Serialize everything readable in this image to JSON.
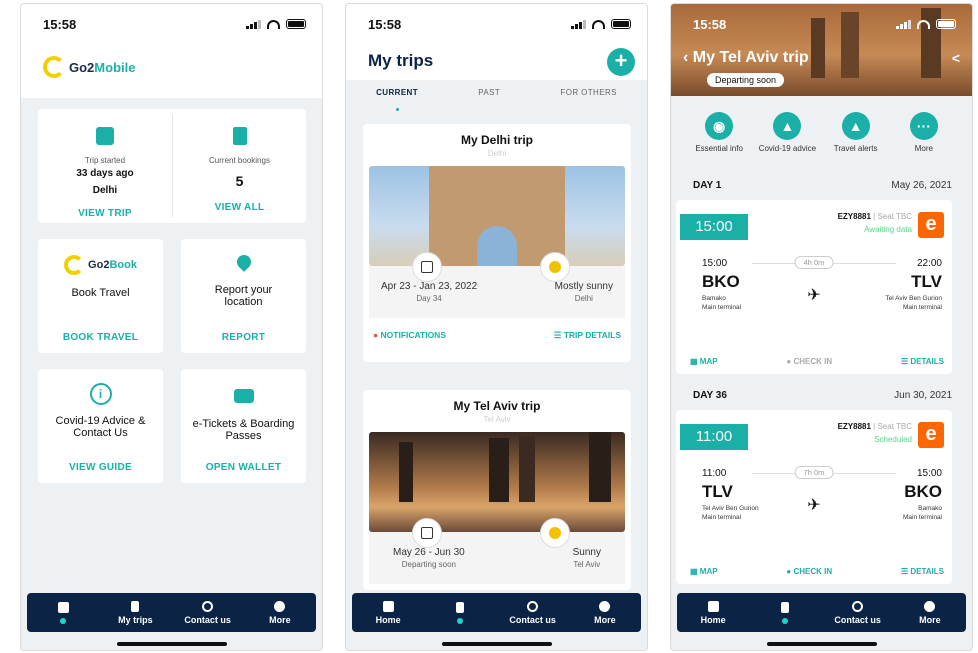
{
  "status_time": "15:58",
  "screen1": {
    "logo": {
      "part1": "Go2",
      "part2": "Mobile"
    },
    "trip_started": {
      "label": "Trip started",
      "value": "33 days ago",
      "place": "Delhi",
      "cta": "VIEW TRIP"
    },
    "bookings": {
      "label": "Current bookings",
      "value": "5",
      "cta": "VIEW ALL"
    },
    "book": {
      "logo1": "Go2",
      "logo2": "Book",
      "title": "Book Travel",
      "cta": "BOOK TRAVEL"
    },
    "report": {
      "title": "Report your location",
      "cta": "REPORT"
    },
    "covid": {
      "title": "Covid-19 Advice & Contact Us",
      "cta": "VIEW GUIDE"
    },
    "tickets": {
      "title": "e-Tickets & Boarding Passes",
      "cta": "OPEN WALLET"
    },
    "tabs": [
      "",
      "My trips",
      "Contact us",
      "More"
    ]
  },
  "screen2": {
    "title": "My trips",
    "subtabs": [
      "CURRENT",
      "PAST",
      "FOR OTHERS"
    ],
    "trip1": {
      "title": "My Delhi trip",
      "sub": "Delhi",
      "dates": "Apr 23 - Jan 23, 2022",
      "day": "Day 34",
      "weather": "Mostly sunny",
      "weather_place": "Delhi",
      "notif": "NOTIFICATIONS",
      "details": "TRIP DETAILS"
    },
    "trip2": {
      "title": "My Tel Aviv trip",
      "sub": "Tel Aviv",
      "dates": "May 26 - Jun 30",
      "day": "Departing soon",
      "weather": "Sunny",
      "weather_place": "Tel Aviv"
    },
    "tabs": [
      "Home",
      "",
      "Contact us",
      "More"
    ]
  },
  "screen3": {
    "title": "My Tel Aviv trip",
    "pill": "Departing soon",
    "actions": [
      "Essential info",
      "Covid-19 advice",
      "Travel alerts",
      "More"
    ],
    "day1": {
      "label": "DAY 1",
      "date": "May 26, 2021"
    },
    "flight1": {
      "time": "15:00",
      "no": "EZY8881",
      "seat": "| Seat TBC",
      "status": "Awaiting data",
      "dep_time": "15:00",
      "arr_time": "22:00",
      "dur": "4h 0m",
      "from": "BKO",
      "to": "TLV",
      "from_name": "Bamako",
      "from_term": "Main terminal",
      "to_name": "Tel Aviv Ben Gurion",
      "to_term": "Main terminal",
      "map": "MAP",
      "checkin": "CHECK IN",
      "details": "DETAILS"
    },
    "day2": {
      "label": "DAY 36",
      "date": "Jun 30, 2021"
    },
    "flight2": {
      "time": "11:00",
      "no": "EZY8881",
      "seat": "| Seat TBC",
      "status": "Scheduled",
      "dep_time": "11:00",
      "arr_time": "15:00",
      "dur": "7h 0m",
      "from": "TLV",
      "to": "BKO",
      "from_name": "Tel Aviv Ben Gurion",
      "from_term": "Main terminal",
      "to_name": "Bamako",
      "to_term": "Main terminal",
      "map": "MAP",
      "checkin": "CHECK IN",
      "details": "DETAILS"
    },
    "tabs": [
      "Home",
      "",
      "Contact us",
      "More"
    ]
  }
}
